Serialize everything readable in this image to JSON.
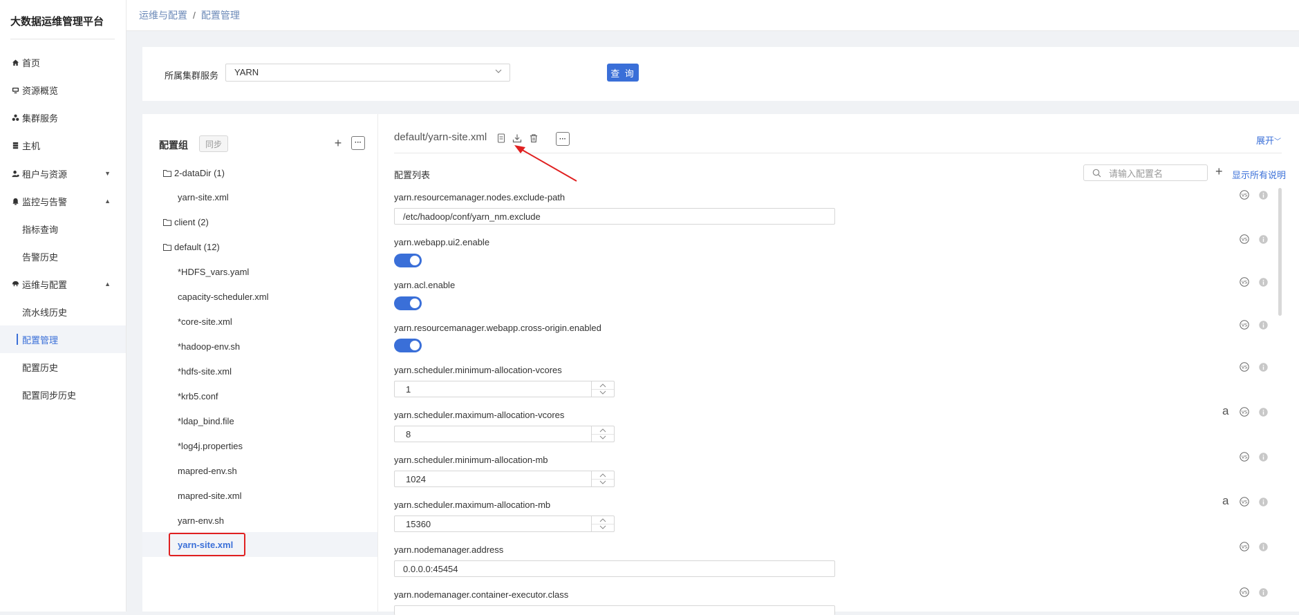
{
  "app": {
    "title": "大数据运维管理平台"
  },
  "sidebar": {
    "items": [
      {
        "label": "首页",
        "icon": "home-icon"
      },
      {
        "label": "资源概览",
        "icon": "monitor-icon"
      },
      {
        "label": "集群服务",
        "icon": "cluster-icon"
      },
      {
        "label": "主机",
        "icon": "server-icon"
      },
      {
        "label": "租户与资源",
        "icon": "user-icon"
      },
      {
        "label": "监控与告警",
        "icon": "bell-icon"
      },
      {
        "label": "运维与配置",
        "icon": "settings-icon"
      }
    ],
    "monitor_sub": [
      "指标查询",
      "告警历史"
    ],
    "ops_sub": [
      "流水线历史",
      "配置管理",
      "配置历史",
      "配置同步历史"
    ]
  },
  "breadcrumb": {
    "parent": "运维与配置",
    "sep": "/",
    "current": "配置管理"
  },
  "filter": {
    "label": "所属集群服务",
    "selected": "YARN",
    "query_label": "查 询"
  },
  "left_panel": {
    "title": "配置组",
    "sync_label": "同步",
    "plus": "+",
    "folders": [
      {
        "label": "2-dataDir (1)",
        "files": [
          "yarn-site.xml"
        ]
      },
      {
        "label": "client (2)",
        "files": []
      },
      {
        "label": "default (12)",
        "files": [
          "*HDFS_vars.yaml",
          "capacity-scheduler.xml",
          "*core-site.xml",
          "*hadoop-env.sh",
          "*hdfs-site.xml",
          "*krb5.conf",
          "*ldap_bind.file",
          "*log4j.properties",
          "mapred-env.sh",
          "mapred-site.xml",
          "yarn-env.sh",
          "yarn-site.xml"
        ]
      }
    ]
  },
  "right_panel": {
    "file_title": "default/yarn-site.xml",
    "expand_label": "展开",
    "list_title": "配置列表",
    "search_placeholder": "请输入配置名",
    "plus": "+",
    "show_all_label": "显示所有说明",
    "props": [
      {
        "name": "yarn.resourcemanager.nodes.exclude-path",
        "value": "/etc/hadoop/conf/yarn_nm.exclude"
      },
      {
        "name": "yarn.webapp.ui2.enable"
      },
      {
        "name": "yarn.acl.enable"
      },
      {
        "name": "yarn.resourcemanager.webapp.cross-origin.enabled"
      },
      {
        "name": "yarn.scheduler.minimum-allocation-vcores",
        "value": "1"
      },
      {
        "name": "yarn.scheduler.maximum-allocation-vcores",
        "value": "8"
      },
      {
        "name": "yarn.scheduler.minimum-allocation-mb",
        "value": "1024"
      },
      {
        "name": "yarn.scheduler.maximum-allocation-mb",
        "value": "15360"
      },
      {
        "name": "yarn.nodemanager.address",
        "value": "0.0.0.0:45454"
      },
      {
        "name": "yarn.nodemanager.container-executor.class"
      }
    ],
    "a_glyph": "a"
  }
}
